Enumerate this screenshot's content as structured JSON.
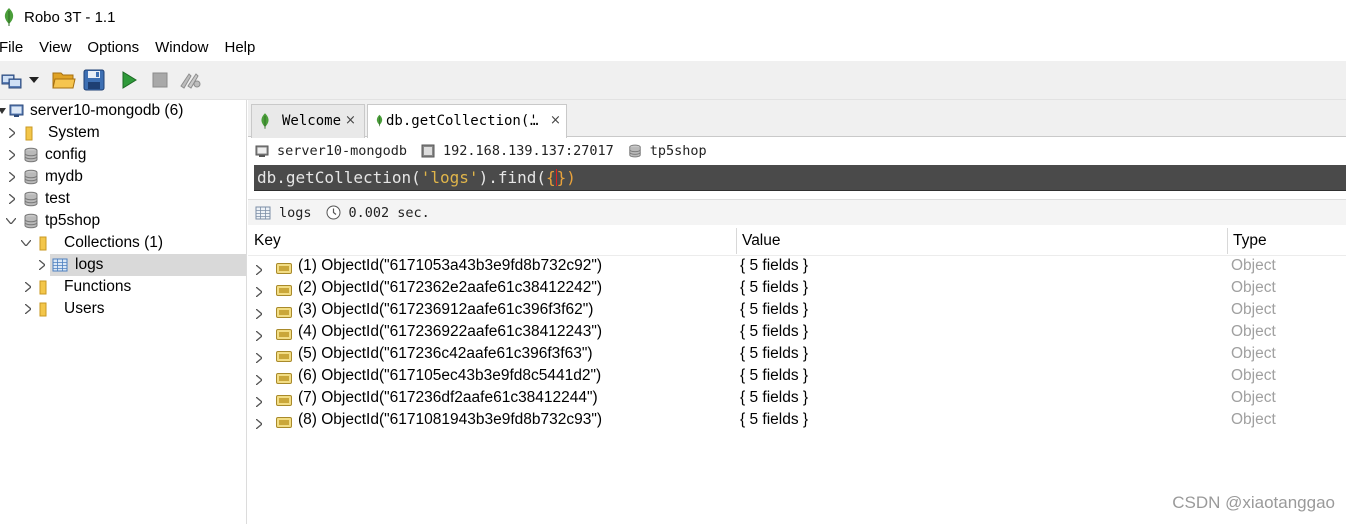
{
  "window": {
    "title": "Robo 3T - 1.1"
  },
  "menu": [
    "File",
    "View",
    "Options",
    "Window",
    "Help"
  ],
  "toolbar": {
    "buttons": [
      "connect-icon",
      "dropdown-arrow-icon",
      "open-folder-icon",
      "save-icon",
      "execute-icon",
      "stop-icon",
      "orientation-icon"
    ]
  },
  "sidebar": {
    "server": "server10-mongodb (6)",
    "dbs": {
      "system": "System",
      "config": "config",
      "mydb": "mydb",
      "test": "test",
      "tp5shop": "tp5shop"
    },
    "collections": "Collections (1)",
    "logs": "logs",
    "functions": "Functions",
    "users": "Users"
  },
  "tabs": {
    "welcome": "Welcome",
    "query": "db.getCollection('",
    "query_more": "…",
    "close": "×"
  },
  "info": {
    "server": "server10-mongodb",
    "address": "192.168.139.137:27017",
    "database": "tp5shop"
  },
  "query": {
    "prefix": "db.getCollection(",
    "string": "'logs'",
    "middle": ").find(",
    "open_brace": "{",
    "close_brace": "})"
  },
  "result": {
    "collection": "logs",
    "time": "0.002 sec."
  },
  "grid": {
    "headers": {
      "key": "Key",
      "value": "Value",
      "type": "Type"
    },
    "rows": [
      {
        "key": "(1) ObjectId(\"6171053a43b3e9fd8b732c92\")",
        "value": "{ 5 fields }",
        "type": "Object"
      },
      {
        "key": "(2) ObjectId(\"6172362e2aafe61c38412242\")",
        "value": "{ 5 fields }",
        "type": "Object"
      },
      {
        "key": "(3) ObjectId(\"617236912aafe61c396f3f62\")",
        "value": "{ 5 fields }",
        "type": "Object"
      },
      {
        "key": "(4) ObjectId(\"617236922aafe61c38412243\")",
        "value": "{ 5 fields }",
        "type": "Object"
      },
      {
        "key": "(5) ObjectId(\"617236c42aafe61c396f3f63\")",
        "value": "{ 5 fields }",
        "type": "Object"
      },
      {
        "key": "(6) ObjectId(\"617105ec43b3e9fd8c5441d2\")",
        "value": "{ 5 fields }",
        "type": "Object"
      },
      {
        "key": "(7) ObjectId(\"617236df2aafe61c38412244\")",
        "value": "{ 5 fields }",
        "type": "Object"
      },
      {
        "key": "(8) ObjectId(\"6171081943b3e9fd8b732c93\")",
        "value": "{ 5 fields }",
        "type": "Object"
      }
    ]
  },
  "watermark": "CSDN @xiaotanggao",
  "colors": {
    "mongo_green": "#4a9e3a",
    "folder_yellow": "#f3c64a",
    "query_bg": "#4a4a4a",
    "selection": "#d9d9d9"
  }
}
